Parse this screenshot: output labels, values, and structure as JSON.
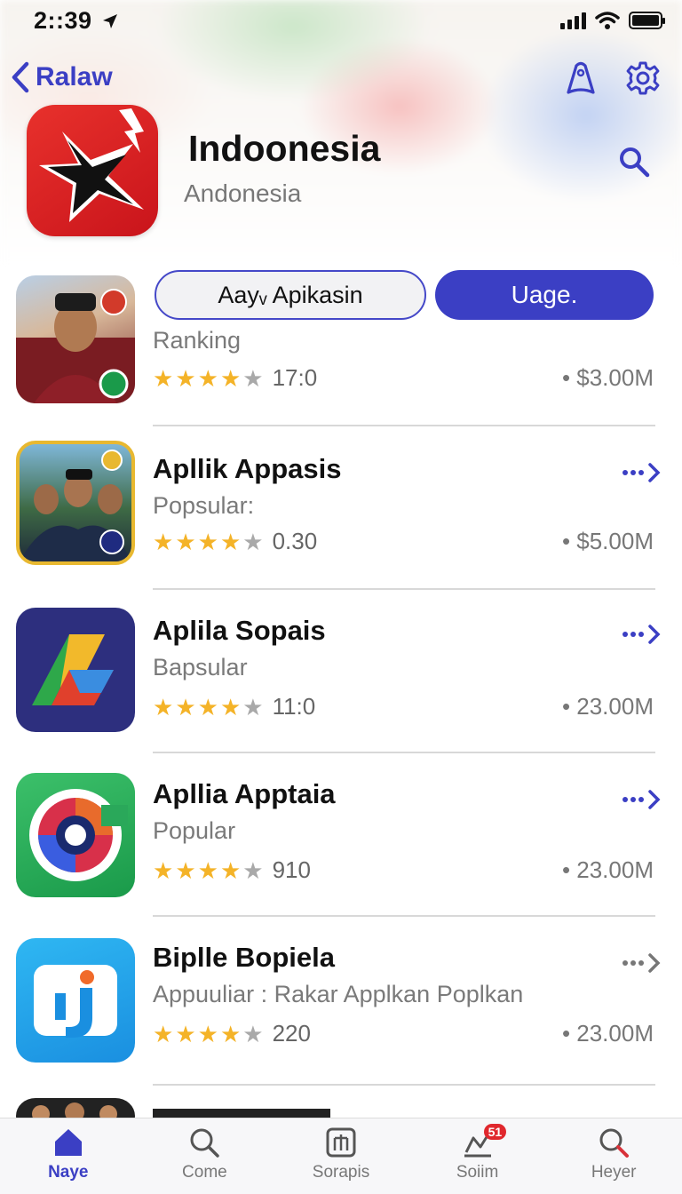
{
  "status_bar": {
    "time": "2::39"
  },
  "nav": {
    "back_label": "Ralaw"
  },
  "header": {
    "title": "Indoonesia",
    "subtitle": "Andonesia"
  },
  "featured": {
    "outline_button": "Aayᵥ Apikasin",
    "filled_button": "Uage.",
    "category": "Ranking",
    "stars": 4,
    "rating_count": "17:0",
    "size": "• $3.00M"
  },
  "apps": [
    {
      "name": "Apllik Appasis",
      "category": "Popsular:",
      "stars": 4,
      "rating_count": "0.30",
      "size": "• $5.00M",
      "more_color": "blue"
    },
    {
      "name": "Aplila Sopais",
      "category": "Bapsular",
      "stars": 4,
      "rating_count": "11:0",
      "size": "• 23.00M",
      "more_color": "blue"
    },
    {
      "name": "Apllia Apptaia",
      "category": "Popular",
      "stars": 4,
      "rating_count": "910",
      "size": "• 23.00M",
      "more_color": "blue"
    },
    {
      "name": "Biplle Bopiela",
      "category": "Appuuliar : Rakar Applkan Poplkan",
      "stars": 4,
      "rating_count": "220",
      "size": "• 23.00M",
      "more_color": "gray"
    }
  ],
  "tabs": [
    {
      "label": "Naye",
      "icon": "home-icon",
      "active": true
    },
    {
      "label": "Come",
      "icon": "search-icon",
      "active": false
    },
    {
      "label": "Sorapis",
      "icon": "apps-icon",
      "active": false
    },
    {
      "label": "Soiim",
      "icon": "updates-icon",
      "active": false,
      "badge": "51"
    },
    {
      "label": "Heyer",
      "icon": "search-icon",
      "active": false
    }
  ],
  "colors": {
    "accent": "#3b3fc4",
    "star": "#f4b328",
    "badge": "#e0272d"
  }
}
